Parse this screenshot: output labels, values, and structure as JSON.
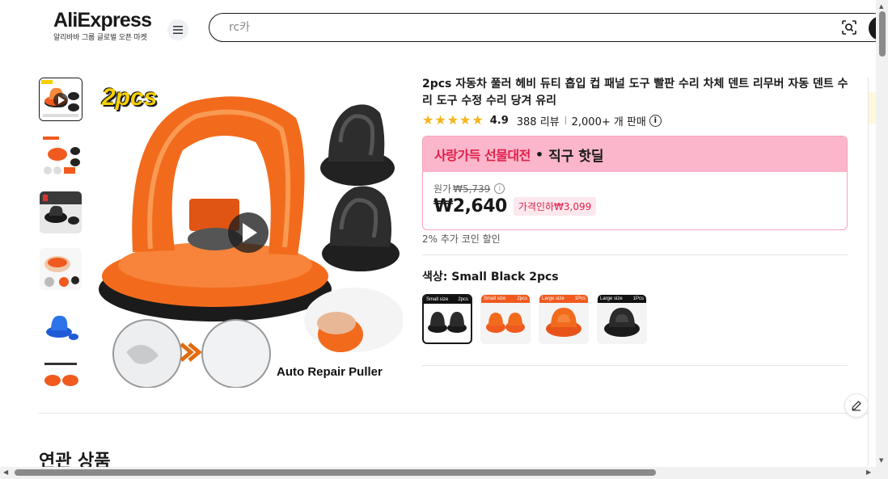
{
  "header": {
    "logo": "AliExpress",
    "logo_sub": "알리바바 그룹 글로벌 오픈 마켓",
    "search_value": "rc카"
  },
  "product": {
    "title": "2pcs 자동차 풀러 헤비 듀티 흡입 컵 패널 도구 빨판 수리 차체 덴트 리무버 자동 덴트 수리 도구 수정 수리 당겨 유리",
    "rating": "4.9",
    "reviews": "388 리뷰",
    "sold": "2,000+ 개 판매",
    "main_image_text_top": "2pcs",
    "main_image_text_bottom": "Auto Repair Puller"
  },
  "deal": {
    "event": "사랑가득 선물대전",
    "dot": "•",
    "label": "직구 핫딜",
    "orig_label": "원가",
    "orig_price": "₩5,739",
    "price": "₩2,640",
    "discount": "가격인하₩3,099",
    "coin": "2% 추가 코인 할인"
  },
  "variants": {
    "label": "색상: Small Black 2pcs",
    "items": [
      {
        "left": "Small size",
        "right": "2pcs",
        "color": "#1a1a1a"
      },
      {
        "left": "Small size",
        "right": "2pcs",
        "color": "#f05a1f"
      },
      {
        "left": "Large size",
        "right": "1Pcs",
        "color": "#f05a1f"
      },
      {
        "left": "Large size",
        "right": "1Pcs",
        "color": "#1a1a1a"
      }
    ]
  },
  "related_title": "연관 상품",
  "colors": {
    "accent": "#e0204a",
    "banner": "#fbb6cb",
    "star": "#f5b41b",
    "product_orange": "#f05a1f"
  }
}
